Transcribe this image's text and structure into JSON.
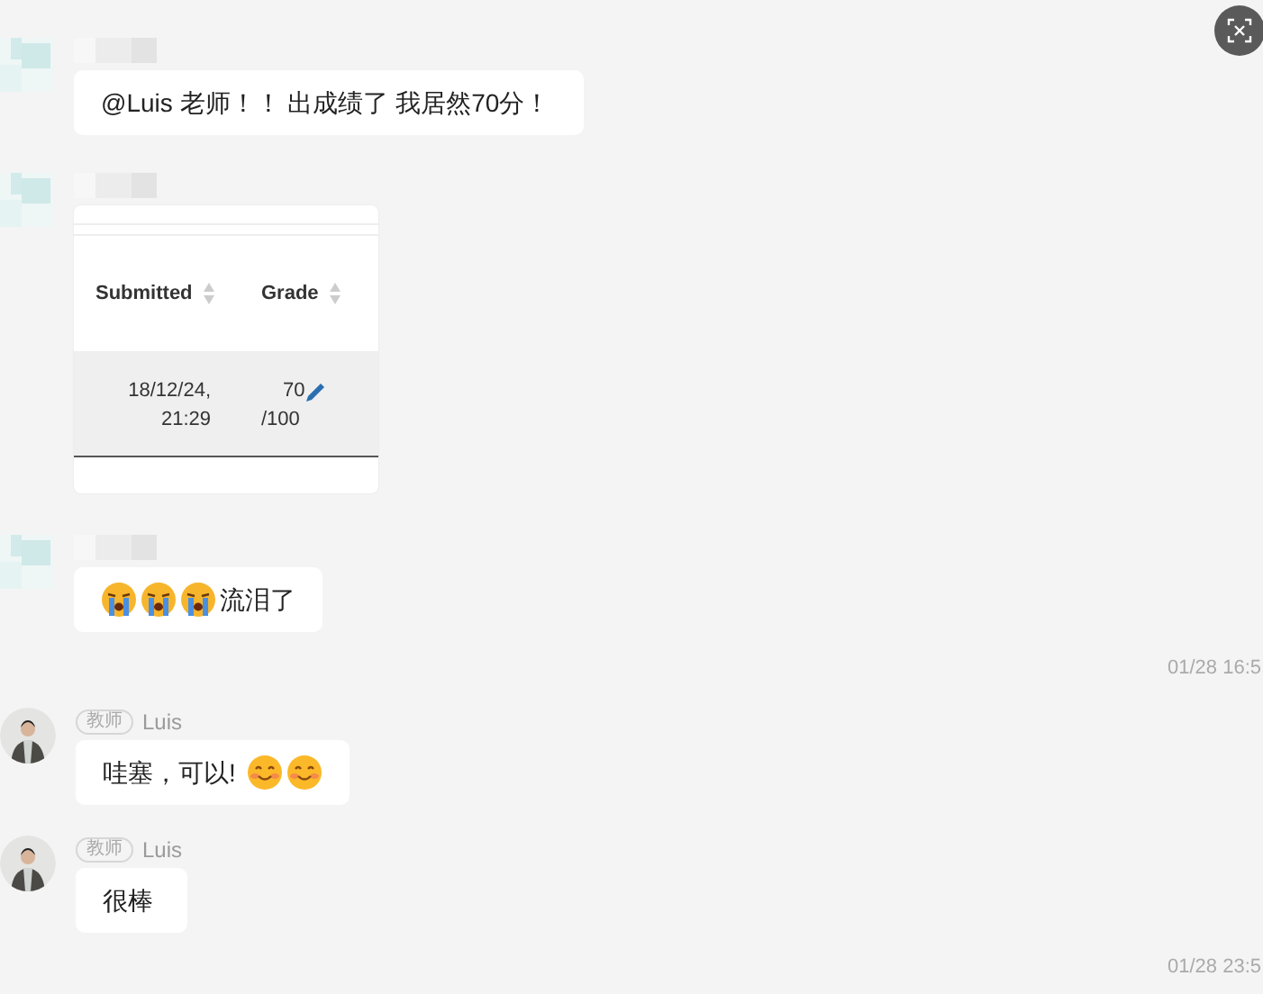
{
  "messages": [
    {
      "kind": "text",
      "sender": {
        "kind": "blurred"
      },
      "content": [
        {
          "kind": "text",
          "text": "@Luis 老师！！ 出成绩了 我居然70分！"
        }
      ]
    },
    {
      "sender": {
        "kind": "blurred"
      },
      "table": {
        "columns": [
          "Submitted",
          "Grade"
        ],
        "rows": [
          {
            "submitted": "18/12/24, 21:29",
            "grade": "70",
            "grade_total": "/100"
          }
        ]
      }
    },
    {
      "kind": "text",
      "sender": {
        "kind": "blurred"
      },
      "content": [
        {
          "kind": "crying"
        },
        {
          "kind": "crying"
        },
        {
          "kind": "crying"
        },
        {
          "kind": "text",
          "text": "流泪了"
        }
      ]
    },
    {
      "kind": "time",
      "time": "01/28 16:5"
    },
    {
      "kind": "text",
      "sender": {
        "kind": "teacher",
        "badge": "教师",
        "name": "Luis"
      },
      "content": [
        {
          "kind": "text",
          "text": "哇塞，可以!"
        },
        {
          "kind": "smiling"
        },
        {
          "kind": "smiling"
        }
      ]
    },
    {
      "kind": "text",
      "sender": {
        "kind": "teacher",
        "badge": "教师",
        "name": "Luis"
      },
      "content": [
        {
          "kind": "text",
          "text": "很棒"
        }
      ]
    },
    {
      "kind": "time",
      "time": "01/28 23:5"
    }
  ]
}
